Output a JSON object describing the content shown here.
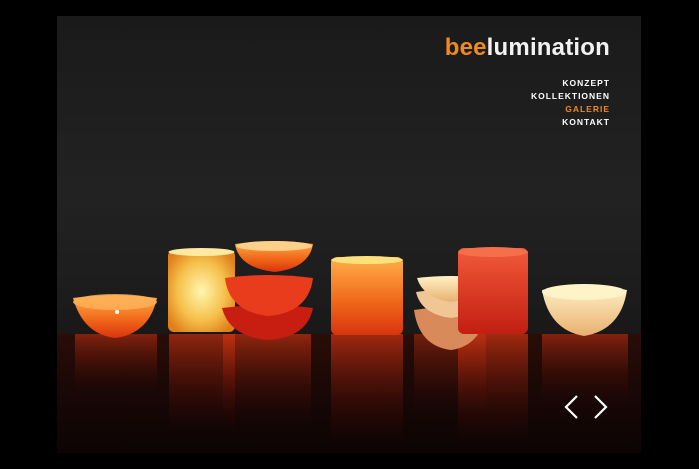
{
  "brand": {
    "part1": "bee",
    "part2": "lumination"
  },
  "nav": {
    "items": [
      {
        "label": "KONZEPT",
        "active": false
      },
      {
        "label": "KOLLEKTIONEN",
        "active": false
      },
      {
        "label": "GALERIE",
        "active": true
      },
      {
        "label": "KONTAKT",
        "active": false
      }
    ]
  },
  "controls": {
    "prev_icon": "chevron-left-icon",
    "next_icon": "chevron-right-icon"
  },
  "colors": {
    "accent": "#f08a1c",
    "text": "#ffffff",
    "frame": "#000000"
  }
}
